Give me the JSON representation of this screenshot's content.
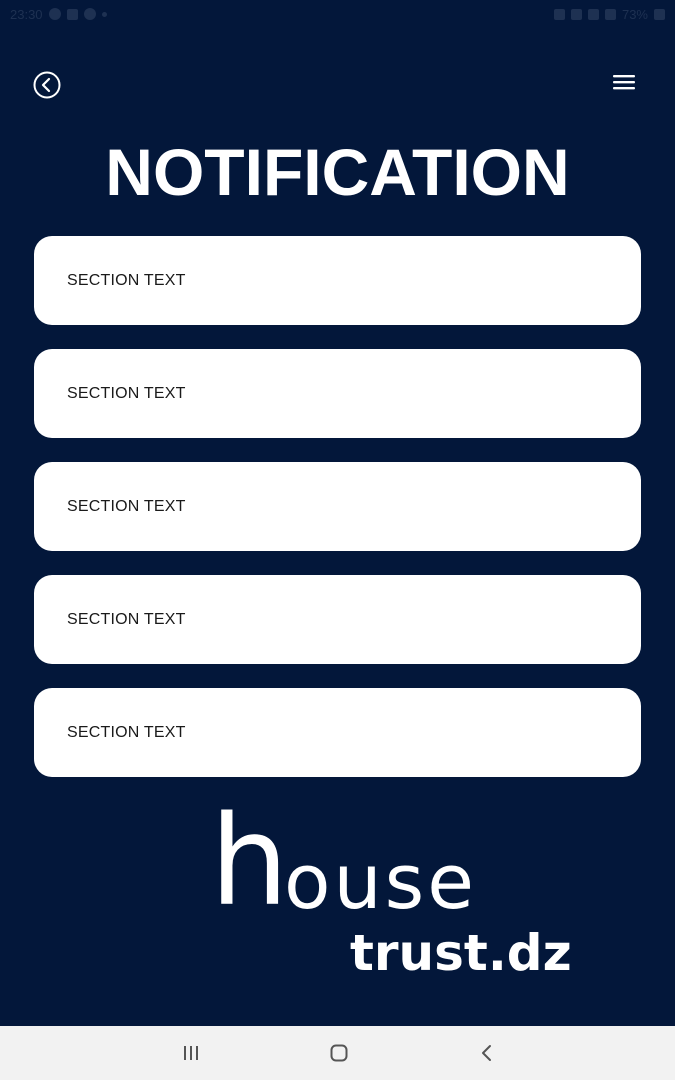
{
  "status_bar": {
    "time": "23:30",
    "battery": "73%"
  },
  "header": {
    "back_icon": "back-circle-icon",
    "menu_icon": "hamburger-menu-icon",
    "title": "NOTIFICATION"
  },
  "sections": [
    {
      "label": "SECTION TEXT"
    },
    {
      "label": "SECTION TEXT"
    },
    {
      "label": "SECTION TEXT"
    },
    {
      "label": "SECTION TEXT"
    },
    {
      "label": "SECTION TEXT"
    }
  ],
  "logo": {
    "h": "h",
    "ouse": "ouse",
    "sub": "trust.dz"
  },
  "nav": {
    "recents_icon": "recents-icon",
    "home_icon": "home-icon",
    "back_icon": "back-chevron-icon"
  },
  "colors": {
    "background": "#03173a",
    "card": "#ffffff",
    "nav_bar": "#f2f2f2"
  }
}
